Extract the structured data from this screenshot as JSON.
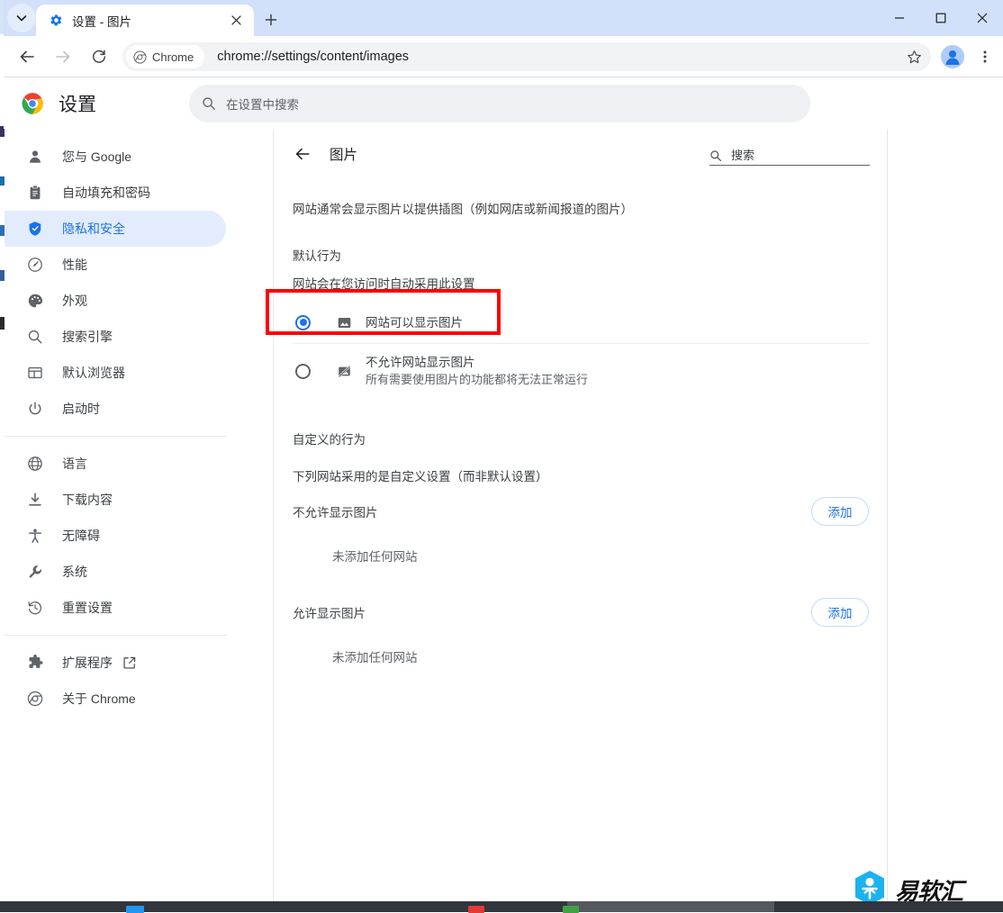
{
  "window": {
    "controls": {
      "minimize": "minimize-button",
      "maximize": "maximize-button",
      "close": "close-button"
    }
  },
  "tabstrip": {
    "tab": {
      "title": "设置 - 图片",
      "favicon": "settings-gear-icon",
      "close_label": "×"
    },
    "new_tab_label": "+",
    "tab_search_label": "⌄"
  },
  "toolbar": {
    "back_label": "←",
    "forward_label": "→",
    "reload_label": "⟳",
    "chrome_chip_label": "Chrome",
    "url": "chrome://settings/content/images",
    "star_label": "☆",
    "profile_label": "profile-avatar",
    "menu_label": "⋮"
  },
  "settings_header": {
    "brand_title": "设置",
    "search_placeholder": "在设置中搜索"
  },
  "sidebar": {
    "items": [
      {
        "label": "您与 Google",
        "icon": "person-icon",
        "selected": false
      },
      {
        "label": "自动填充和密码",
        "icon": "clipboard-icon",
        "selected": false
      },
      {
        "label": "隐私和安全",
        "icon": "shield-icon",
        "selected": true
      },
      {
        "label": "性能",
        "icon": "speedometer-icon",
        "selected": false
      },
      {
        "label": "外观",
        "icon": "palette-icon",
        "selected": false
      },
      {
        "label": "搜索引擎",
        "icon": "magnifier-icon",
        "selected": false
      },
      {
        "label": "默认浏览器",
        "icon": "browser-window-icon",
        "selected": false
      },
      {
        "label": "启动时",
        "icon": "power-icon",
        "selected": false
      }
    ],
    "items2": [
      {
        "label": "语言",
        "icon": "globe-icon",
        "selected": false
      },
      {
        "label": "下载内容",
        "icon": "download-icon",
        "selected": false
      },
      {
        "label": "无障碍",
        "icon": "accessibility-icon",
        "selected": false
      },
      {
        "label": "系统",
        "icon": "wrench-icon",
        "selected": false
      },
      {
        "label": "重置设置",
        "icon": "history-restore-icon",
        "selected": false
      }
    ],
    "items3": [
      {
        "label": "扩展程序",
        "icon": "puzzle-icon",
        "external": true
      },
      {
        "label": "关于 Chrome",
        "icon": "chrome-logo-icon",
        "external": false
      }
    ]
  },
  "page": {
    "back_label": "←",
    "title": "图片",
    "search_placeholder": "搜索",
    "description": "网站通常会显示图片以提供插图（例如网店或新闻报道的图片）",
    "default_behavior": {
      "heading": "默认行为",
      "subtext": "网站会在您访问时自动采用此设置",
      "options": [
        {
          "label": "网站可以显示图片",
          "sublabel": "",
          "icon": "image-icon",
          "selected": true,
          "highlighted": true
        },
        {
          "label": "不允许网站显示图片",
          "sublabel": "所有需要使用图片的功能都将无法正常运行",
          "icon": "image-blocked-icon",
          "selected": false,
          "highlighted": false
        }
      ]
    },
    "custom_behavior": {
      "heading": "自定义的行为",
      "subtext": "下列网站采用的是自定义设置（而非默认设置）",
      "groups": [
        {
          "label": "不允许显示图片",
          "add_label": "添加",
          "empty_text": "未添加任何网站"
        },
        {
          "label": "允许显示图片",
          "add_label": "添加",
          "empty_text": "未添加任何网站"
        }
      ]
    }
  },
  "watermark": {
    "text": "易软汇",
    "logo": "hexagon-badge-icon",
    "color": "#1ab0f0"
  },
  "colors": {
    "accent": "#1a73e8",
    "selected_nav_bg": "#e3ecfd",
    "tabstrip_bg": "#d2e0f9",
    "highlight_box": "#ff0000",
    "text_primary": "#3c4043",
    "text_secondary": "#5f6368"
  }
}
